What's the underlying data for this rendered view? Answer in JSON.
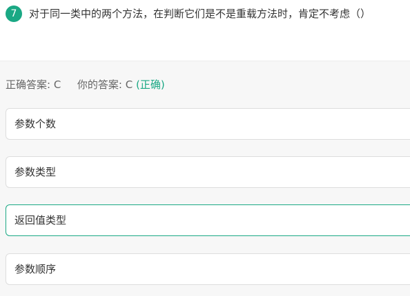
{
  "question": {
    "number": "7",
    "text": "对于同一类中的两个方法，在判断它们是不是重载方法时，肯定不考虑（）"
  },
  "result": {
    "correct_label": "正确答案:",
    "correct_value": "C",
    "your_label": "你的答案:",
    "your_value": "C",
    "status": "(正确)"
  },
  "options": [
    {
      "label": "参数个数",
      "selected": false
    },
    {
      "label": "参数类型",
      "selected": false
    },
    {
      "label": "返回值类型",
      "selected": true
    },
    {
      "label": "参数顺序",
      "selected": false
    }
  ],
  "colors": {
    "accent": "#1aa884",
    "text": "#333333",
    "muted": "#666666",
    "border": "#dddddd",
    "panel_bg": "#f7f7f7"
  }
}
